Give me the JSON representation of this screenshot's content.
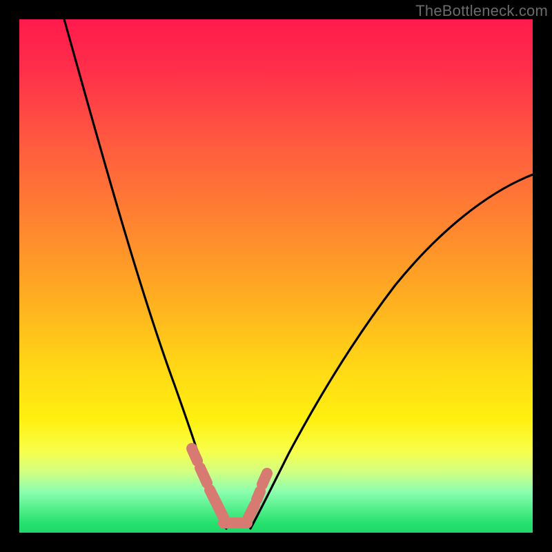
{
  "watermark": "TheBottleneck.com",
  "chart_data": {
    "type": "line",
    "title": "",
    "xlabel": "",
    "ylabel": "",
    "xlim": [
      0,
      100
    ],
    "ylim": [
      0,
      100
    ],
    "series": [
      {
        "name": "left-curve",
        "x": [
          9,
          12,
          15,
          18,
          21,
          24,
          26,
          28,
          30,
          32,
          33,
          34,
          35,
          36,
          37,
          38,
          39
        ],
        "values": [
          100,
          88,
          76,
          65,
          55,
          45,
          38,
          31,
          25,
          19,
          16,
          13,
          10,
          7,
          5,
          3,
          2
        ]
      },
      {
        "name": "right-curve",
        "x": [
          44,
          46,
          48,
          51,
          55,
          60,
          66,
          73,
          80,
          88,
          95,
          100
        ],
        "values": [
          2,
          5,
          9,
          14,
          21,
          29,
          38,
          47,
          55,
          62,
          67,
          70
        ]
      },
      {
        "name": "highlight-segments",
        "x": [
          33,
          34,
          36,
          38,
          41,
          43,
          44,
          45,
          47
        ],
        "values": [
          16,
          12,
          4,
          2,
          2,
          4,
          7,
          11,
          14
        ]
      }
    ],
    "colors": {
      "curve": "#000000",
      "highlight": "#d77a72",
      "gradient_top": "#ff1a4d",
      "gradient_bottom": "#1fd768"
    }
  }
}
